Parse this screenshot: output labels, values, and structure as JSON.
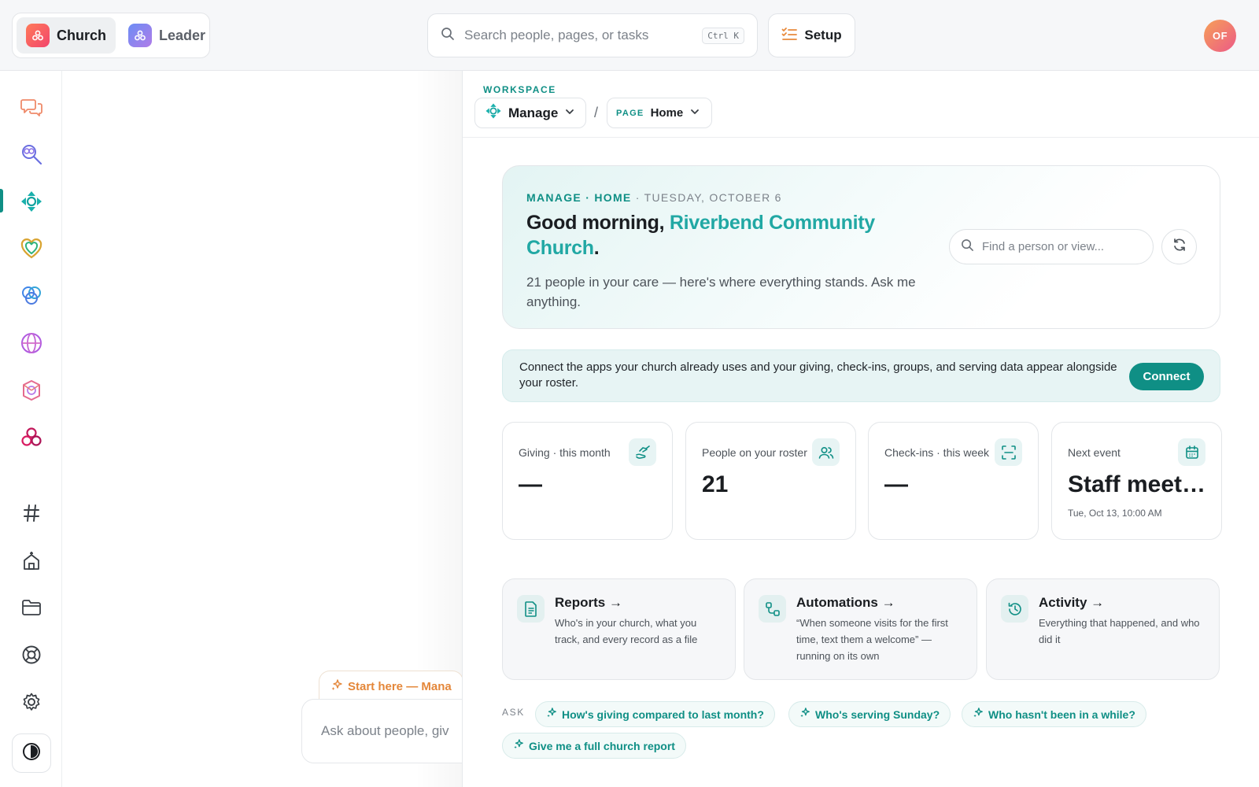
{
  "topbar": {
    "switcher": [
      {
        "label": "Church",
        "active": true,
        "icon": "church-logo-icon"
      },
      {
        "label": "Leader",
        "active": false,
        "icon": "leader-logo-icon"
      }
    ],
    "search": {
      "placeholder": "Search people, pages, or tasks",
      "shortcut": "Ctrl K"
    },
    "setup_label": "Setup",
    "avatar_initials": "OF"
  },
  "rail": {
    "active_item": "manage",
    "items": [
      "chat-icon",
      "search-people-icon",
      "manage-icon",
      "care-heart-icon",
      "connect-icon",
      "global-icon",
      "groups-icon",
      "serve-icon",
      "channels-hash-icon",
      "church-building-icon",
      "folder-icon",
      "help-lifebuoy-icon",
      "settings-gear-icon"
    ],
    "theme_toggle": "theme-toggle-icon"
  },
  "chat": {
    "start_pill": "Start here — Mana",
    "input_placeholder": "Ask about people, giv"
  },
  "breadcrumb": {
    "workspace_label": "WORKSPACE",
    "workspace_value": "Manage",
    "separator": "/",
    "page_tag": "PAGE",
    "page_value": "Home"
  },
  "hero": {
    "eyebrow_section": "MANAGE · HOME",
    "eyebrow_date": " · TUESDAY, OCTOBER 6",
    "greeting": "Good morning, ",
    "church_name": "Riverbend Community Church",
    "period": ".",
    "subtitle": "21 people in your care — here's where everything stands. Ask me anything.",
    "find_placeholder": "Find a person or view..."
  },
  "banner": {
    "text": "Connect the apps your church already uses and your giving, check-ins, groups, and serving data appear alongside your roster.",
    "button_label": "Connect"
  },
  "stats": [
    {
      "label": "Giving · this month",
      "value": "—",
      "sub": "",
      "icon": "giving-hand-icon"
    },
    {
      "label": "People on your roster",
      "value": "21",
      "sub": "",
      "icon": "people-icon"
    },
    {
      "label": "Check-ins · this week",
      "value": "—",
      "sub": "",
      "icon": "scan-icon"
    },
    {
      "label": "Next event",
      "value": "Staff meeting",
      "sub": "Tue, Oct 13, 10:00 AM",
      "icon": "calendar-icon"
    }
  ],
  "quick_links": [
    {
      "title": "Reports →",
      "desc": "Who's in your church, what you track, and every record as a file",
      "icon": "report-document-icon"
    },
    {
      "title": "Automations →",
      "desc": "“When someone visits for the first time, text them a welcome” — running on its own",
      "icon": "automation-flow-icon"
    },
    {
      "title": "Activity →",
      "desc": "Everything that happened, and who did it",
      "icon": "history-clock-icon"
    }
  ],
  "ask": {
    "label": "ASK",
    "chips": [
      "How's giving compared to last month?",
      "Who's serving Sunday?",
      "Who hasn't been in a while?",
      "Give me a full church report"
    ]
  },
  "colors": {
    "accent": "#0f8f85",
    "accent_light": "#21a8a4",
    "orange": "#e4873a"
  }
}
